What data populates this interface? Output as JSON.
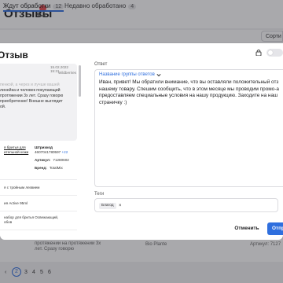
{
  "page": {
    "title": "Отзывы",
    "tabs": [
      {
        "label": "Ждут обработки",
        "count": "12"
      },
      {
        "label": "Недавно обработано",
        "count": "4"
      }
    ],
    "sort_label": "Сорти"
  },
  "background_row": {
    "text": "протяжении на протяжении 3х лет. Сразу говорю",
    "col2": "Bio Plante",
    "col3": "Артикул: 7127"
  },
  "pagination": {
    "prev": "‹",
    "current": "2",
    "pages": [
      "3",
      "4",
      "5",
      "6"
    ]
  },
  "modal": {
    "title": "Отзыв",
    "review": {
      "date": "15.02.2022 15:31",
      "shop": "Wildberries",
      "lines": [
        "пенкой, а через и лучше вашей",
        "линейка и человек покупающий",
        "протяжении 3х лет. Сразу говорю",
        "приобретение! Внешне выглядит",
        "ой."
      ]
    },
    "product": {
      "name": "я бритья для\nительной кожи",
      "article_label": "Штрихкод",
      "article_value": "4607041780597",
      "article_more": "+22",
      "sku_label": "Артикул:",
      "sku_value": "71280602",
      "brand_label": "Бренд:",
      "brand_value": "TotalMix"
    },
    "list_items": [
      "я с тройным лезвием",
      "ия Active 95ml",
      "набор для бритья Освежающий,\nобов"
    ],
    "answer": {
      "label": "Ответ",
      "templates_label": "Название группы ответов",
      "text_lines": [
        "Иван, привет! Мы обратили внимание, что вы оставляли положительный отз",
        "нашему товару. Спешим сообщить, что в этом месяце мы проводим промо-а",
        "предоставляем специальные условия на нашу продукцию. Заходите на наш",
        "страничку :)"
      ]
    },
    "tags": {
      "label": "Теги",
      "items": [
        "Благод"
      ]
    },
    "buttons": {
      "cancel": "Отменить",
      "send": "Отпр"
    }
  },
  "colors": {
    "accent": "#2f6fde",
    "badge": "#e5484d",
    "overlay": "rgba(40,40,48,0.40)"
  }
}
